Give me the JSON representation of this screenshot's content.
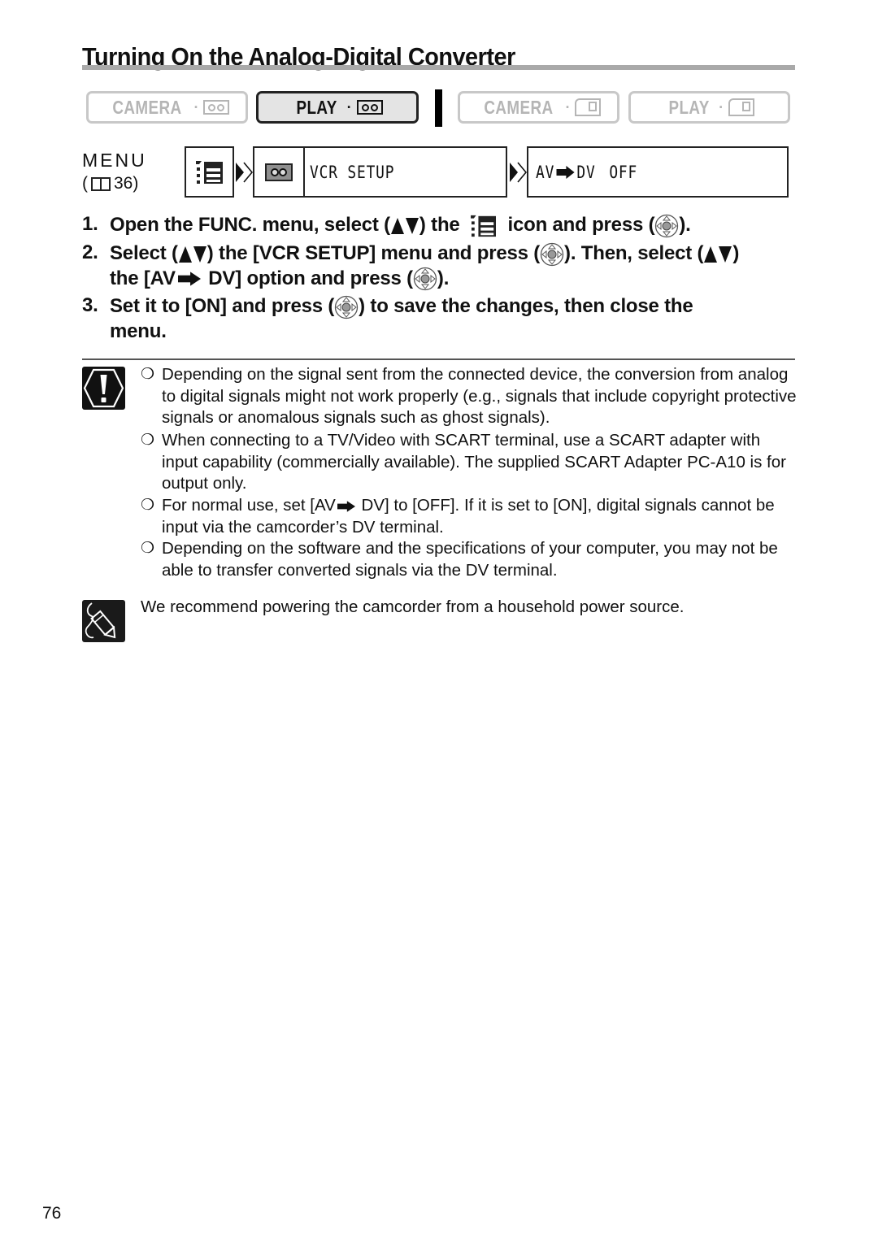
{
  "page": {
    "title": "Turning On the Analog-Digital Converter",
    "page_number": "76"
  },
  "modes": [
    {
      "label": "CAMERA",
      "media": "tape",
      "active": false
    },
    {
      "label": "PLAY",
      "media": "tape",
      "active": true
    },
    {
      "label": "CAMERA",
      "media": "card",
      "active": false
    },
    {
      "label": "PLAY",
      "media": "card",
      "active": false
    }
  ],
  "mode_separator": "·",
  "menu_path": {
    "label": "MENU",
    "ref_open": "(",
    "ref_page": "36)",
    "func_icon": "menu-list-icon",
    "submenu": "VCR SETUP",
    "submenu_icon": "cassette-icon",
    "setting_a": "AV",
    "setting_b": "DV",
    "setting_value": "OFF"
  },
  "steps": [
    {
      "num": "1.",
      "parts": [
        "Open the FUNC. menu, select (",
        ") the ",
        " icon and press (",
        ")."
      ]
    },
    {
      "num": "2.",
      "parts": [
        "Select (",
        ") the [VCR SETUP] menu and press (",
        "). Then, select (",
        ")",
        "the [AV",
        " DV] option and press (",
        ")."
      ]
    },
    {
      "num": "3.",
      "parts": [
        "Set it to [ON] and press (",
        ") to save the changes, then close the",
        "menu."
      ]
    }
  ],
  "caution": {
    "icon": "caution-icon",
    "bullets": [
      "Depending on the signal sent from the connected device, the conversion from analog to digital signals might not work properly (e.g., signals that include copyright protective signals or anomalous signals such as ghost signals).",
      "When connecting to a TV/Video with SCART terminal, use a SCART adapter with input capability (commercially available). The supplied SCART Adapter PC-A10 is for output only.",
      [
        "For normal use, set [AV",
        " DV] to [OFF]. If it is set to [ON], digital signals cannot be input via the camcorder’s DV terminal."
      ],
      "Depending on the software and the specifications of your computer, you may not be able to transfer converted signals via the DV terminal."
    ],
    "bullet_mark": "❍"
  },
  "note": {
    "icon": "note-pencil-icon",
    "text": "We recommend powering the camcorder from a household power source."
  }
}
